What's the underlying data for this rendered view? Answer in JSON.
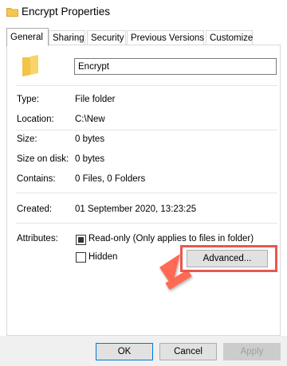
{
  "window": {
    "title": "Encrypt Properties"
  },
  "tabs": [
    {
      "label": "General",
      "active": true
    },
    {
      "label": "Sharing",
      "active": false
    },
    {
      "label": "Security",
      "active": false
    },
    {
      "label": "Previous Versions",
      "active": false
    },
    {
      "label": "Customize",
      "active": false
    }
  ],
  "folder": {
    "name_value": "Encrypt",
    "icon": "folder-icon"
  },
  "properties": [
    {
      "label": "Type:",
      "value": "File folder"
    },
    {
      "label": "Location:",
      "value": "C:\\New"
    },
    {
      "label": "Size:",
      "value": "0 bytes"
    },
    {
      "label": "Size on disk:",
      "value": "0 bytes"
    },
    {
      "label": "Contains:",
      "value": "0 Files, 0 Folders"
    }
  ],
  "created": {
    "label": "Created:",
    "value": "01 September 2020, 13:23:25"
  },
  "attributes": {
    "label": "Attributes:",
    "readonly_label": "Read-only (Only applies to files in folder)",
    "readonly_state": "indeterminate",
    "hidden_label": "Hidden",
    "hidden_checked": false,
    "advanced_label": "Advanced..."
  },
  "footer": {
    "ok_label": "OK",
    "cancel_label": "Cancel",
    "apply_label": "Apply"
  },
  "colors": {
    "accent": "#0078d7",
    "annotation": "#e8584c",
    "folder": "#f6c74e"
  }
}
